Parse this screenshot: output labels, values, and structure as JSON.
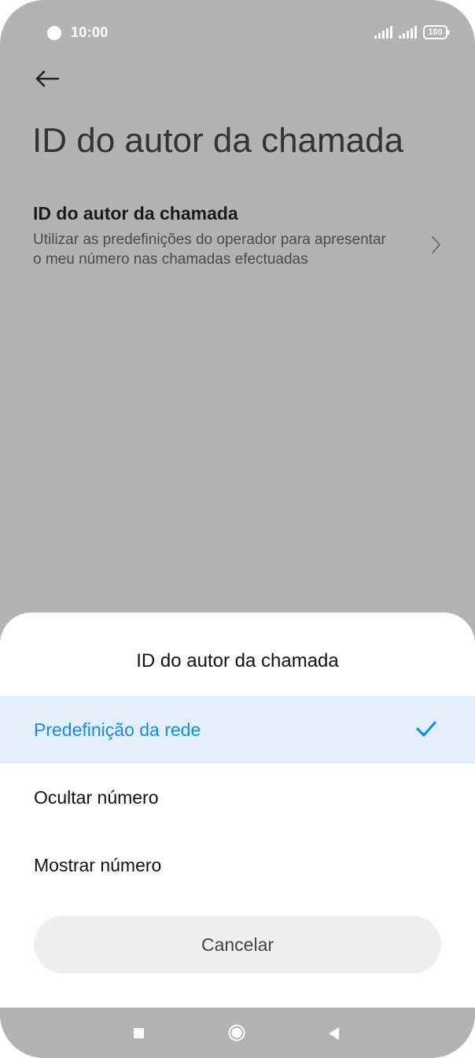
{
  "status_bar": {
    "time": "10:00",
    "battery": "100"
  },
  "header": {
    "title": "ID do autor da chamada"
  },
  "setting": {
    "title": "ID do autor da chamada",
    "description": "Utilizar as predefinições do operador para apresentar o meu número nas chamadas efectuadas"
  },
  "sheet": {
    "title": "ID do autor da chamada",
    "options": [
      {
        "label": "Predefinição da rede",
        "selected": true
      },
      {
        "label": "Ocultar número",
        "selected": false
      },
      {
        "label": "Mostrar número",
        "selected": false
      }
    ],
    "cancel_label": "Cancelar"
  },
  "colors": {
    "accent": "#1a8ae5",
    "selected_background": "#e3f0fc",
    "scrim": "#b3b3b3"
  },
  "icons": [
    "back-arrow-icon",
    "chevron-right-icon",
    "checkmark-icon",
    "signal-icon",
    "battery-icon",
    "recent-apps-icon",
    "home-icon",
    "back-triangle-icon"
  ]
}
